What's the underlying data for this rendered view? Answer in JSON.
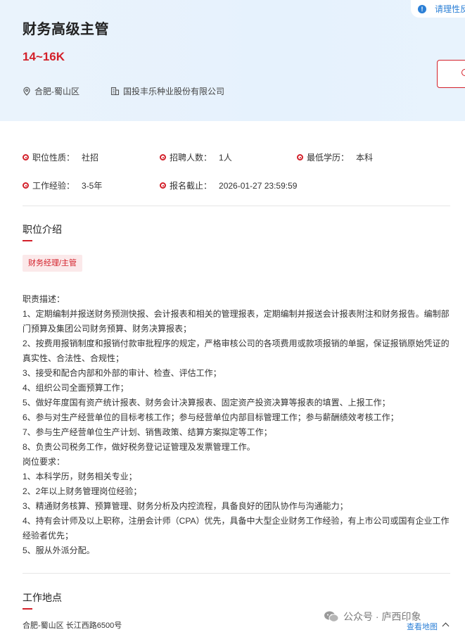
{
  "header": {
    "title": "财务高级主管",
    "salary": "14~16K",
    "location": "合肥-蜀山区",
    "company": "国投丰乐种业股份有限公司",
    "login_tip": "请理性反",
    "login_tip_icon": "info-icon",
    "accent_color": "#d3202a"
  },
  "info": [
    {
      "label": "职位性质：",
      "value": "社招"
    },
    {
      "label": "招聘人数：",
      "value": "1人"
    },
    {
      "label": "最低学历：",
      "value": "本科"
    },
    {
      "label": "工作经验：",
      "value": "3-5年"
    },
    {
      "label": "报名截止：",
      "value": "2026-01-27 23:59:59"
    }
  ],
  "intro": {
    "title": "职位介绍",
    "tag": "财务经理/主管",
    "lines": [
      "职责描述：",
      "1、定期编制并报送财务预测快报、会计报表和相关的管理报表，定期编制并报送会计报表附注和财务报告。编制部",
      "门预算及集团公司财务预算、财务决算报表；",
      "2、按费用报销制度和报销付款审批程序的规定，严格审核公司的各项费用或款项报销的单据，保证报销原始凭证的",
      "真实性、合法性、合规性；",
      "3、接受和配合内部和外部的审计、检查、评估工作；",
      "4、组织公司全面预算工作；",
      "5、做好年度国有资产统计报表、财务会计决算报表、固定资产投资决算等报表的填置、上报工作；",
      "6、参与对生产经营单位的目标考核工作；参与经营单位内部目标管理工作；参与薪酬绩效考核工作；",
      "7、参与生产经营单位生产计划、销售政策、结算方案拟定等工作；",
      "8、负责公司税务工作，做好税务登记证管理及发票管理工作。",
      "岗位要求：",
      "1、本科学历，财务相关专业；",
      "2、2年以上财务管理岗位经验；",
      "3、精通财务核算、预算管理、财务分析及内控流程，具备良好的团队协作与沟通能力；",
      "4、持有会计师及以上职称，注册会计师（CPA）优先，具备中大型企业财务工作经验，有上市公司或国有企业工作",
      "经验者优先；",
      "5、服从外派分配。"
    ]
  },
  "workplace": {
    "title": "工作地点",
    "address": "合肥-蜀山区 长江西路6500号",
    "map_link": "查看地图"
  },
  "watermark": "公众号 · 庐西印象"
}
